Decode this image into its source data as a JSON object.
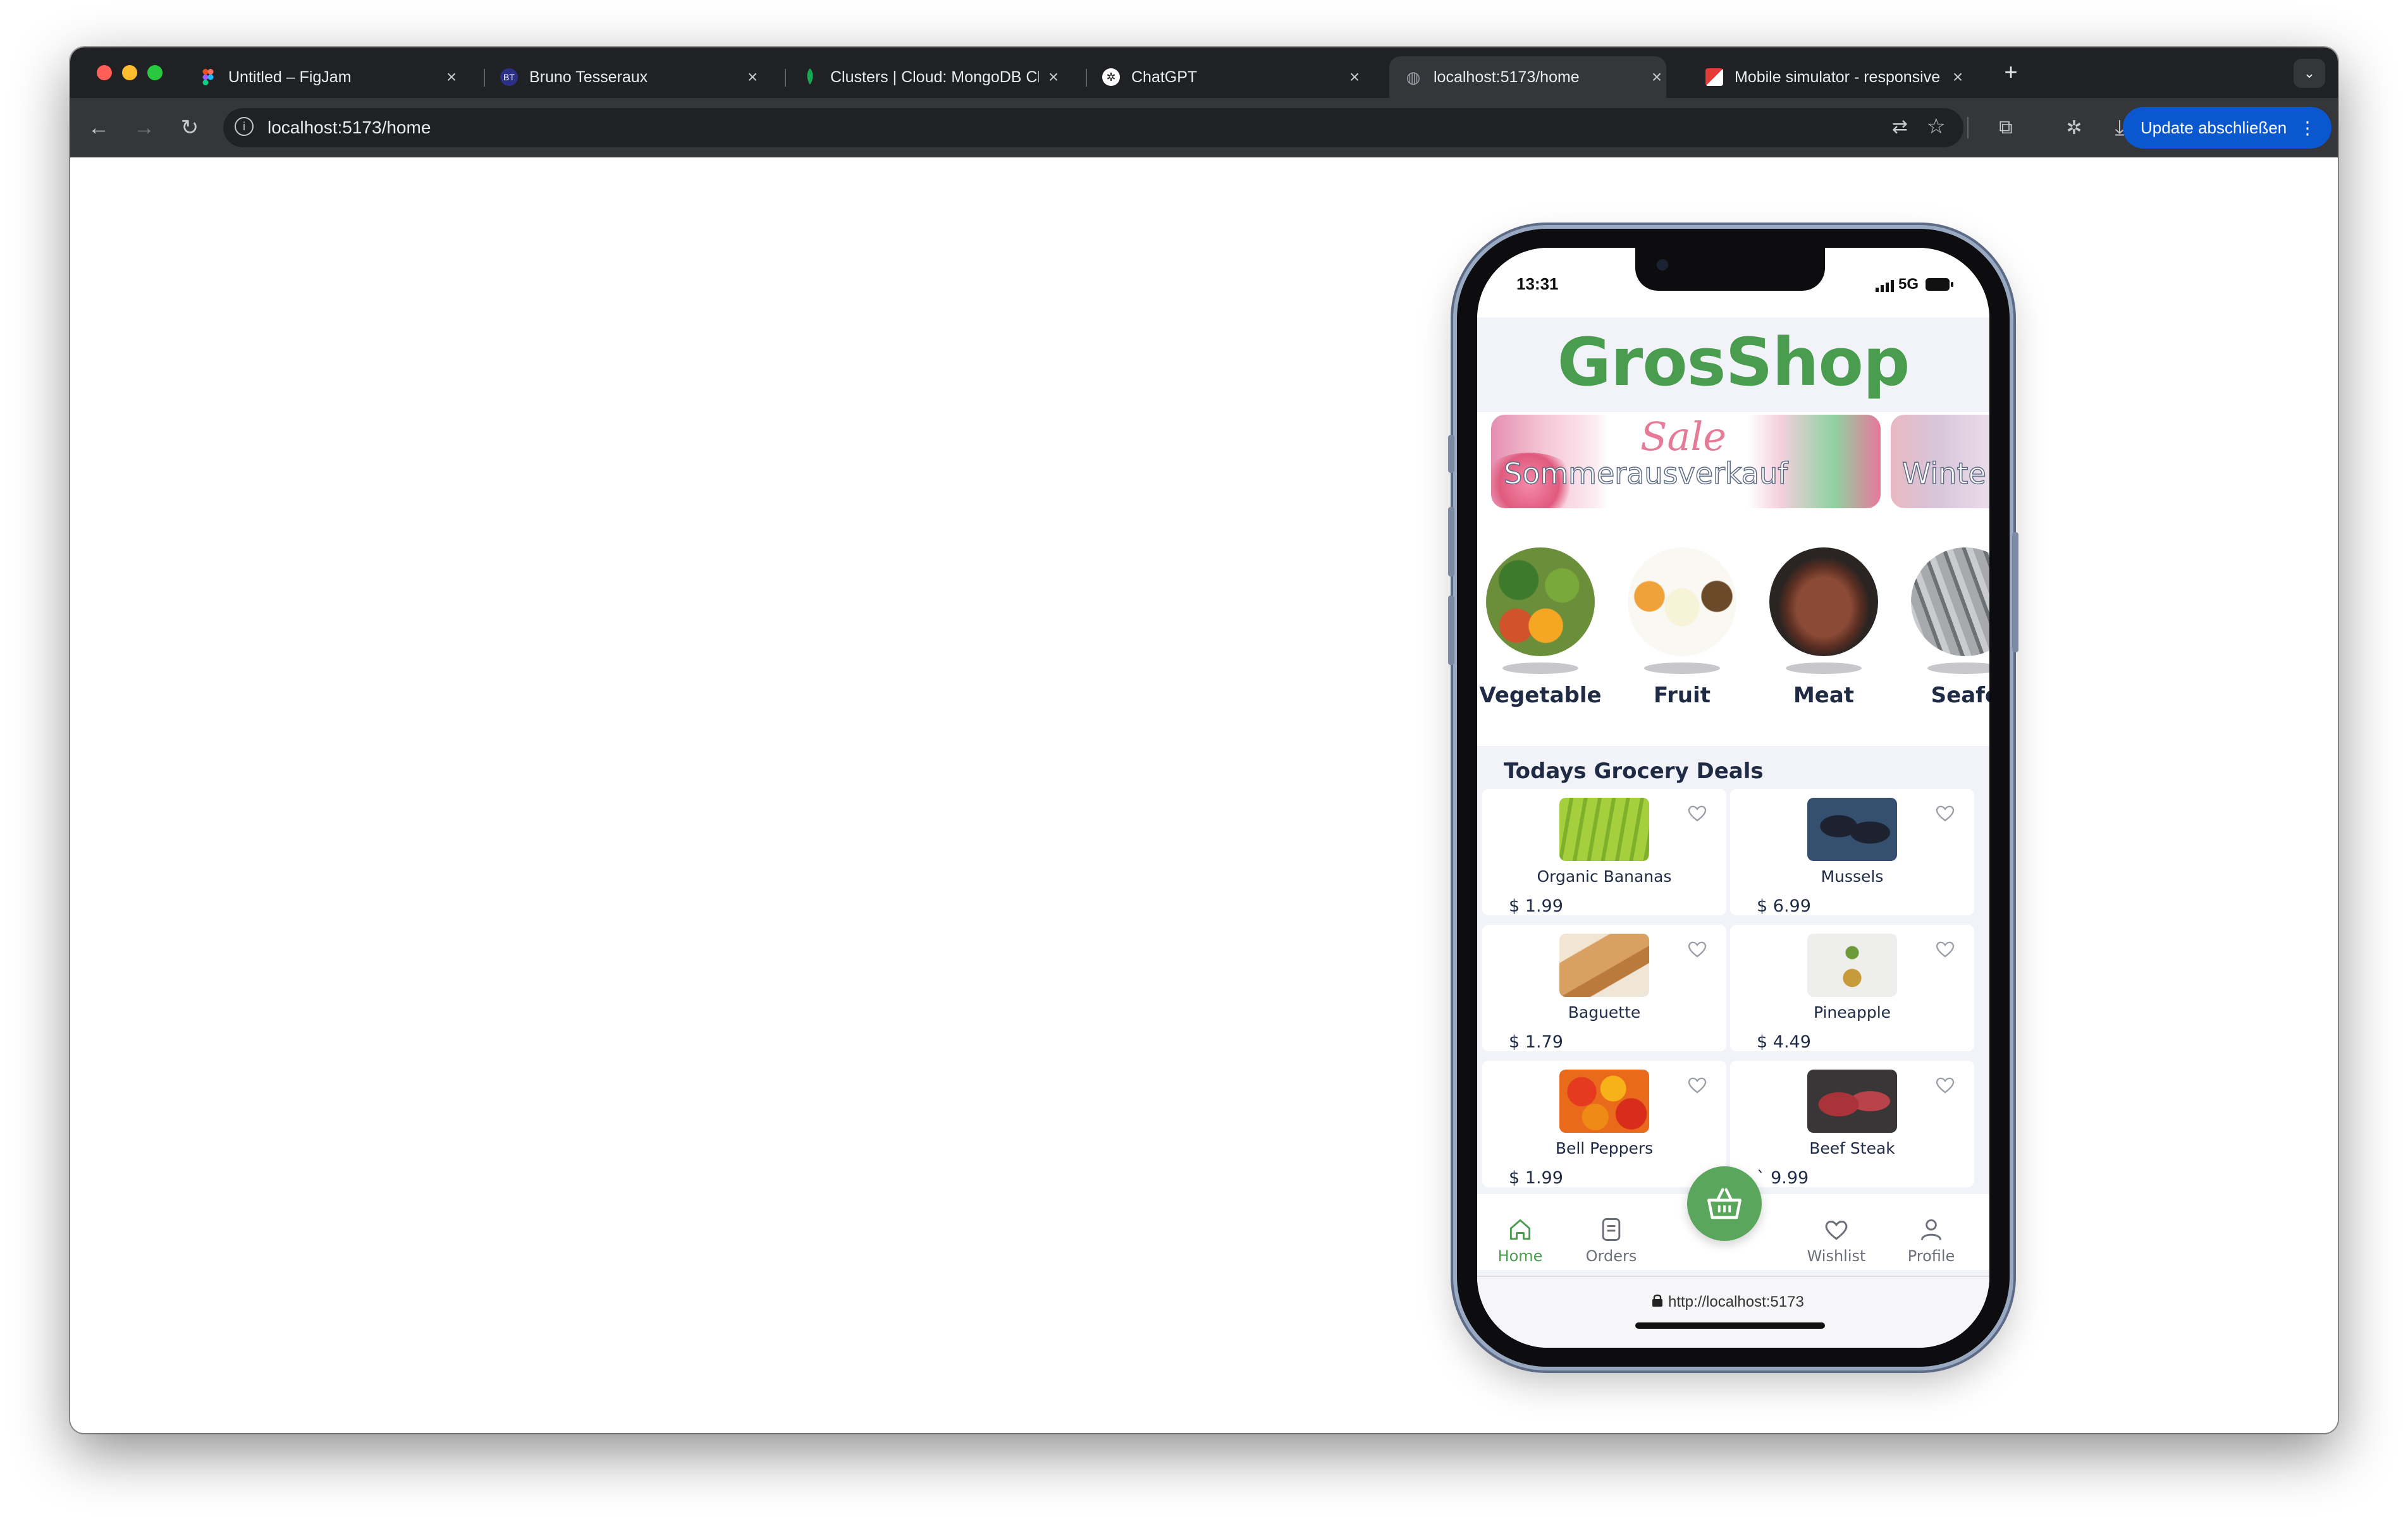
{
  "browser": {
    "tabs": [
      {
        "title": "Untitled – FigJam",
        "icon": "figma-icon"
      },
      {
        "title": "Bruno Tesseraux",
        "icon": "profile-logo-icon"
      },
      {
        "title": "Clusters | Cloud: MongoDB Cl",
        "icon": "mongodb-leaf-icon"
      },
      {
        "title": "ChatGPT",
        "icon": "chatgpt-icon"
      },
      {
        "title": "localhost:5173/home",
        "icon": "globe-icon",
        "active": true
      },
      {
        "title": "Mobile simulator - responsive",
        "icon": "simulator-icon"
      }
    ],
    "address": "localhost:5173/home",
    "update_button": "Update abschließen"
  },
  "phone": {
    "status": {
      "time": "13:31",
      "network": "5G"
    },
    "logo": "GrosShop",
    "banners": [
      {
        "title": "Sommerausverkauf",
        "badge": "Sale"
      },
      {
        "title": "Winte"
      }
    ],
    "categories": [
      "Vegetable",
      "Fruit",
      "Meat",
      "Seafo"
    ],
    "deals_title": "Todays Grocery Deals",
    "products": [
      {
        "name": "Organic Bananas",
        "price": "$ 1.99"
      },
      {
        "name": "Mussels",
        "price": "$ 6.99"
      },
      {
        "name": "Baguette",
        "price": "$ 1.79"
      },
      {
        "name": "Pineapple",
        "price": "$ 4.49"
      },
      {
        "name": "Bell Peppers",
        "price": "$ 1.99"
      },
      {
        "name": "Beef Steak",
        "price": "` 9.99"
      }
    ],
    "nav": {
      "home": "Home",
      "orders": "Orders",
      "wishlist": "Wishlist",
      "profile": "Profile"
    },
    "url": "http://localhost:5173"
  },
  "colors": {
    "brand_green": "#4a9d4e",
    "text_navy": "#1f2a44",
    "update_blue": "#0b57d0"
  }
}
